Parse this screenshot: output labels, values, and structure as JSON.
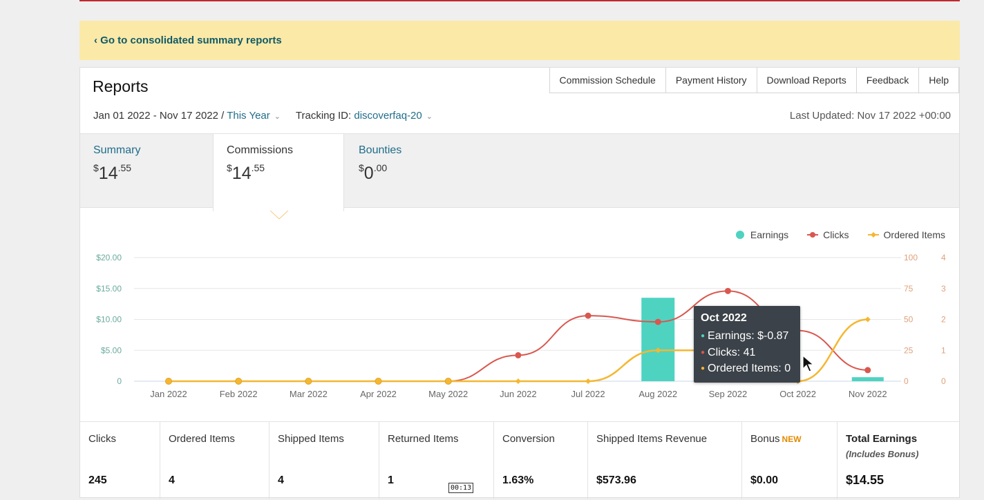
{
  "banner": {
    "link_text": "‹ Go to consolidated summary reports"
  },
  "header": {
    "title": "Reports",
    "nav": [
      "Commission Schedule",
      "Payment History",
      "Download Reports",
      "Feedback",
      "Help"
    ]
  },
  "filters": {
    "date_range": "Jan 01 2022 - Nov 17 2022 /",
    "period": "This Year",
    "tracking_label": "Tracking ID:",
    "tracking_id": "discoverfaq-20",
    "last_updated": "Last Updated: Nov 17 2022 +00:00"
  },
  "tabs": [
    {
      "label": "Summary",
      "currency": "$",
      "whole": "14",
      "cents": ".55"
    },
    {
      "label": "Commissions",
      "currency": "$",
      "whole": "14",
      "cents": ".55"
    },
    {
      "label": "Bounties",
      "currency": "$",
      "whole": "0",
      "cents": ".00"
    }
  ],
  "legend": {
    "earnings": "Earnings",
    "clicks": "Clicks",
    "ordered": "Ordered Items"
  },
  "colors": {
    "earnings": "#4ed3c1",
    "clicks": "#d9574f",
    "ordered": "#f5b731",
    "link": "#1f6d8a",
    "banner": "#fbe9a8"
  },
  "tooltip": {
    "title": "Oct 2022",
    "earnings": "Earnings: $-0.87",
    "clicks": "Clicks: 41",
    "ordered": "Ordered Items: 0"
  },
  "chart_data": {
    "type": "bar",
    "categories": [
      "Jan 2022",
      "Feb 2022",
      "Mar 2022",
      "Apr 2022",
      "May 2022",
      "Jun 2022",
      "Jul 2022",
      "Aug 2022",
      "Sep 2022",
      "Oct 2022",
      "Nov 2022"
    ],
    "y_left_ticks": [
      "$20.00",
      "$15.00",
      "$10.00",
      "$5.00",
      "0"
    ],
    "y_left_range": [
      0,
      20
    ],
    "y_right1_ticks": [
      "100",
      "75",
      "50",
      "25",
      "0"
    ],
    "y_right1_range": [
      0,
      100
    ],
    "y_right2_ticks": [
      "4",
      "3",
      "2",
      "1",
      "0"
    ],
    "y_right2_range": [
      0,
      4
    ],
    "grid": true,
    "legend_position": "top-right",
    "series": [
      {
        "name": "Earnings",
        "type": "bar",
        "axis": "left",
        "values": [
          0,
          0,
          0,
          0,
          0,
          0,
          0,
          13.5,
          0,
          -0.87,
          0.65
        ]
      },
      {
        "name": "Clicks",
        "type": "line",
        "axis": "right1",
        "values": [
          0,
          0,
          0,
          0,
          0,
          21,
          53,
          48,
          73,
          41,
          9
        ]
      },
      {
        "name": "Ordered Items",
        "type": "line",
        "axis": "right2",
        "values": [
          0,
          0,
          0,
          0,
          0,
          0,
          0,
          1,
          1,
          0,
          2
        ]
      }
    ]
  },
  "stats": [
    {
      "label": "Clicks",
      "value": "245"
    },
    {
      "label": "Ordered Items",
      "value": "4"
    },
    {
      "label": "Shipped Items",
      "value": "4"
    },
    {
      "label": "Returned Items",
      "value": "1"
    },
    {
      "label": "Conversion",
      "value": "1.63%"
    },
    {
      "label": "Shipped Items Revenue",
      "value": "$573.96"
    },
    {
      "label": "Bonus",
      "badge": "NEW",
      "value": "$0.00"
    },
    {
      "label": "Total Earnings",
      "sub": "(Includes Bonus)",
      "value": "$14.55"
    }
  ],
  "video_timestamp": "00:13"
}
